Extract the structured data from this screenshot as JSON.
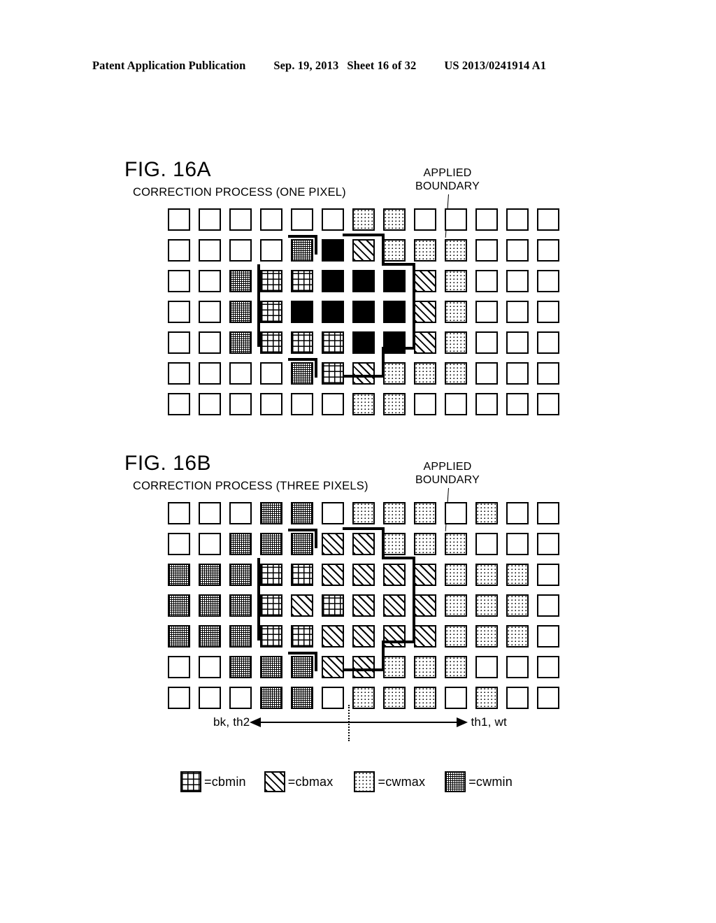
{
  "header": {
    "publication": "Patent Application Publication",
    "date": "Sep. 19, 2013",
    "sheet": "Sheet 16 of 32",
    "patent_number": "US 2013/0241914 A1"
  },
  "figures": [
    {
      "id": "fig-16a",
      "title": "FIG. 16A",
      "subtitle": "CORRECTION PROCESS (ONE PIXEL)",
      "annotation": "APPLIED\nBOUNDARY",
      "annotation_line1": "APPLIED",
      "annotation_line2": "BOUNDARY",
      "columns": 13,
      "rows": 7,
      "grid": [
        [
          "white",
          "white",
          "white",
          "white",
          "white",
          "white",
          "cwmax",
          "cwmax",
          "white",
          "white",
          "white",
          "white",
          "white"
        ],
        [
          "white",
          "white",
          "white",
          "white",
          "cwmin",
          "black",
          "cbmax",
          "cwmax",
          "cwmax",
          "cwmax",
          "white",
          "white",
          "white"
        ],
        [
          "white",
          "white",
          "cwmin",
          "cbmin",
          "cbmin",
          "black",
          "black",
          "black",
          "cbmax",
          "cwmax",
          "white",
          "white",
          "white"
        ],
        [
          "white",
          "white",
          "cwmin",
          "cbmin",
          "black",
          "black",
          "black",
          "black",
          "cbmax",
          "cwmax",
          "white",
          "white",
          "white"
        ],
        [
          "white",
          "white",
          "cwmin",
          "cbmin",
          "cbmin",
          "cbmin",
          "black",
          "black",
          "cbmax",
          "cwmax",
          "white",
          "white",
          "white"
        ],
        [
          "white",
          "white",
          "white",
          "white",
          "cwmin",
          "cbmin",
          "cbmax",
          "cwmax",
          "cwmax",
          "cwmax",
          "white",
          "white",
          "white"
        ],
        [
          "white",
          "white",
          "white",
          "white",
          "white",
          "white",
          "cwmax",
          "cwmax",
          "white",
          "white",
          "white",
          "white",
          "white"
        ]
      ]
    },
    {
      "id": "fig-16b",
      "title": "FIG. 16B",
      "subtitle": "CORRECTION PROCESS (THREE PIXELS)",
      "annotation_line1": "APPLIED",
      "annotation_line2": "BOUNDARY",
      "columns": 13,
      "rows": 7,
      "grid": [
        [
          "white",
          "white",
          "white",
          "cwmin",
          "cwmin",
          "white",
          "cwmax",
          "cwmax",
          "cwmax",
          "white",
          "cwmax",
          "white",
          "white"
        ],
        [
          "white",
          "white",
          "cwmin",
          "cwmin",
          "cwmin",
          "cbmax",
          "cbmax",
          "cwmax",
          "cwmax",
          "cwmax",
          "white",
          "white",
          "white"
        ],
        [
          "cwmin",
          "cwmin",
          "cwmin",
          "cbmin",
          "cbmin",
          "cbmax",
          "cbmax",
          "cbmax",
          "cbmax",
          "cwmax",
          "cwmax",
          "cwmax",
          "white"
        ],
        [
          "cwmin",
          "cwmin",
          "cwmin",
          "cbmin",
          "cbmax",
          "cbmin",
          "cbmax",
          "cbmax",
          "cbmax",
          "cwmax",
          "cwmax",
          "cwmax",
          "white"
        ],
        [
          "cwmin",
          "cwmin",
          "cwmin",
          "cbmin",
          "cbmin",
          "cbmax",
          "cbmax",
          "cbmax",
          "cbmax",
          "cwmax",
          "cwmax",
          "cwmax",
          "white"
        ],
        [
          "white",
          "white",
          "cwmin",
          "cwmin",
          "cwmin",
          "cbmax",
          "cbmax",
          "cwmax",
          "cwmax",
          "cwmax",
          "white",
          "white",
          "white"
        ],
        [
          "white",
          "white",
          "white",
          "cwmin",
          "cwmin",
          "white",
          "cwmax",
          "cwmax",
          "cwmax",
          "white",
          "cwmax",
          "white",
          "white"
        ]
      ],
      "axis": {
        "left_label": "bk, th2",
        "right_label": "th1, wt"
      }
    }
  ],
  "legend": {
    "items": [
      {
        "pattern": "cbmin",
        "equals": "=",
        "label": "cbmin"
      },
      {
        "pattern": "cbmax",
        "equals": "=",
        "label": "cbmax"
      },
      {
        "pattern": "cwmax",
        "equals": "=",
        "label": "cwmax"
      },
      {
        "pattern": "cwmin",
        "equals": "=",
        "label": "cwmin"
      }
    ]
  },
  "colors": {
    "ink": "#000000",
    "paper": "#ffffff"
  }
}
